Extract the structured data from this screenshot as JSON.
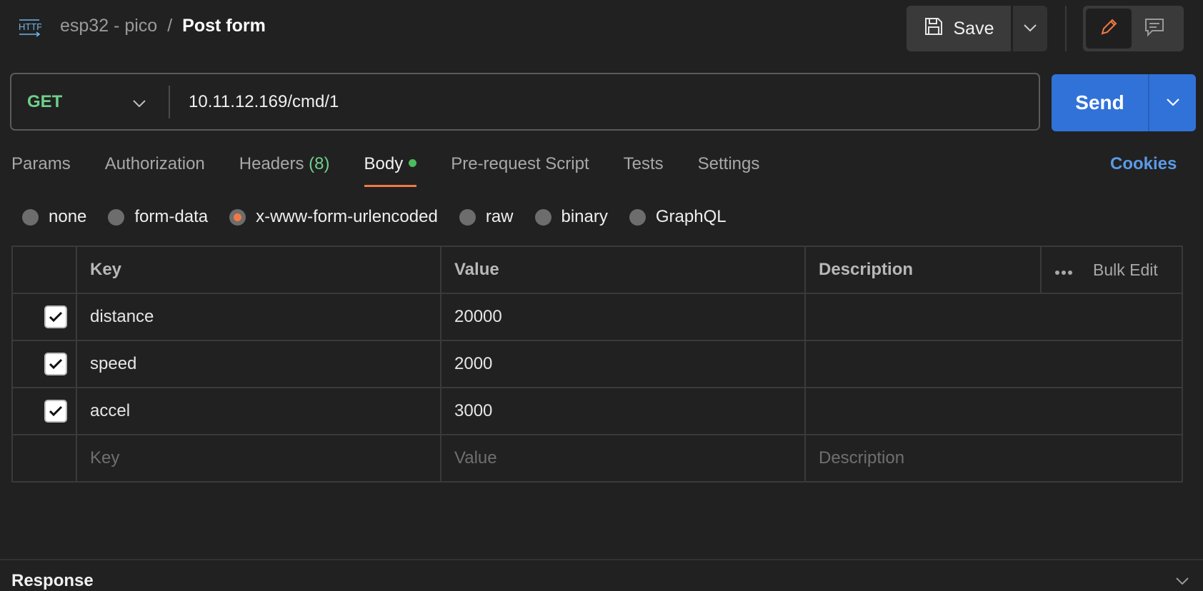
{
  "header": {
    "icon": "http-icon",
    "breadcrumb_parent": "esp32 - pico",
    "breadcrumb_separator": "/",
    "breadcrumb_current": "Post form",
    "save_label": "Save"
  },
  "request": {
    "method": "GET",
    "url": "10.11.12.169/cmd/1",
    "send_label": "Send"
  },
  "tabs": [
    {
      "label": "Params"
    },
    {
      "label": "Authorization"
    },
    {
      "label": "Headers",
      "count": "(8)"
    },
    {
      "label": "Body",
      "active": true
    },
    {
      "label": "Pre-request Script"
    },
    {
      "label": "Tests"
    },
    {
      "label": "Settings"
    }
  ],
  "cookies_label": "Cookies",
  "body_types": [
    {
      "label": "none"
    },
    {
      "label": "form-data"
    },
    {
      "label": "x-www-form-urlencoded",
      "selected": true
    },
    {
      "label": "raw"
    },
    {
      "label": "binary"
    },
    {
      "label": "GraphQL"
    }
  ],
  "table": {
    "headers": {
      "key": "Key",
      "value": "Value",
      "description": "Description",
      "bulk_edit": "Bulk Edit"
    },
    "rows": [
      {
        "key": "distance",
        "value": "20000",
        "description": "",
        "checked": true
      },
      {
        "key": "speed",
        "value": "2000",
        "description": "",
        "checked": true
      },
      {
        "key": "accel",
        "value": "3000",
        "description": "",
        "checked": true
      }
    ],
    "placeholder": {
      "key": "Key",
      "value": "Value",
      "description": "Description"
    }
  },
  "response_label": "Response",
  "colors": {
    "accent": "#f07a45",
    "send": "#3172d8",
    "method": "#6fcf8a",
    "cookies": "#5b9ae6"
  }
}
